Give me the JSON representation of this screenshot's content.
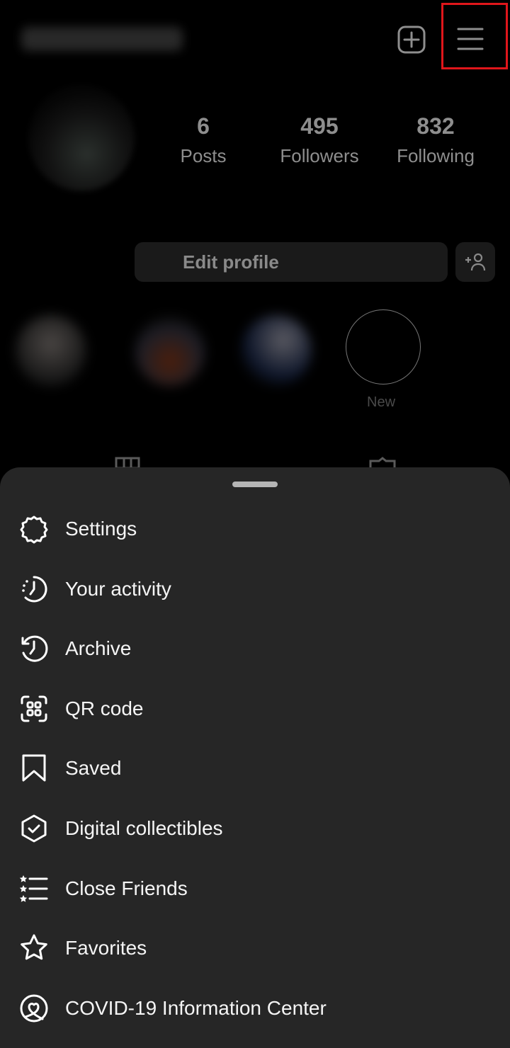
{
  "header": {
    "add_icon": "plus-square-icon",
    "menu_icon": "hamburger-menu-icon",
    "highlight_color": "#e0161b"
  },
  "stats": [
    {
      "value": "6",
      "label": "Posts"
    },
    {
      "value": "495",
      "label": "Followers"
    },
    {
      "value": "832",
      "label": "Following"
    }
  ],
  "profile": {
    "edit_label": "Edit profile"
  },
  "stories": {
    "new_label": "New"
  },
  "menu": {
    "background": "#262626",
    "items": [
      {
        "label": "Settings",
        "icon": "settings-icon"
      },
      {
        "label": "Your activity",
        "icon": "activity-icon"
      },
      {
        "label": "Archive",
        "icon": "archive-icon"
      },
      {
        "label": "QR code",
        "icon": "qr-code-icon"
      },
      {
        "label": "Saved",
        "icon": "bookmark-icon"
      },
      {
        "label": "Digital collectibles",
        "icon": "collectibles-icon"
      },
      {
        "label": "Close Friends",
        "icon": "close-friends-icon"
      },
      {
        "label": "Favorites",
        "icon": "star-icon"
      },
      {
        "label": "COVID-19 Information Center",
        "icon": "covid-info-icon"
      }
    ]
  }
}
